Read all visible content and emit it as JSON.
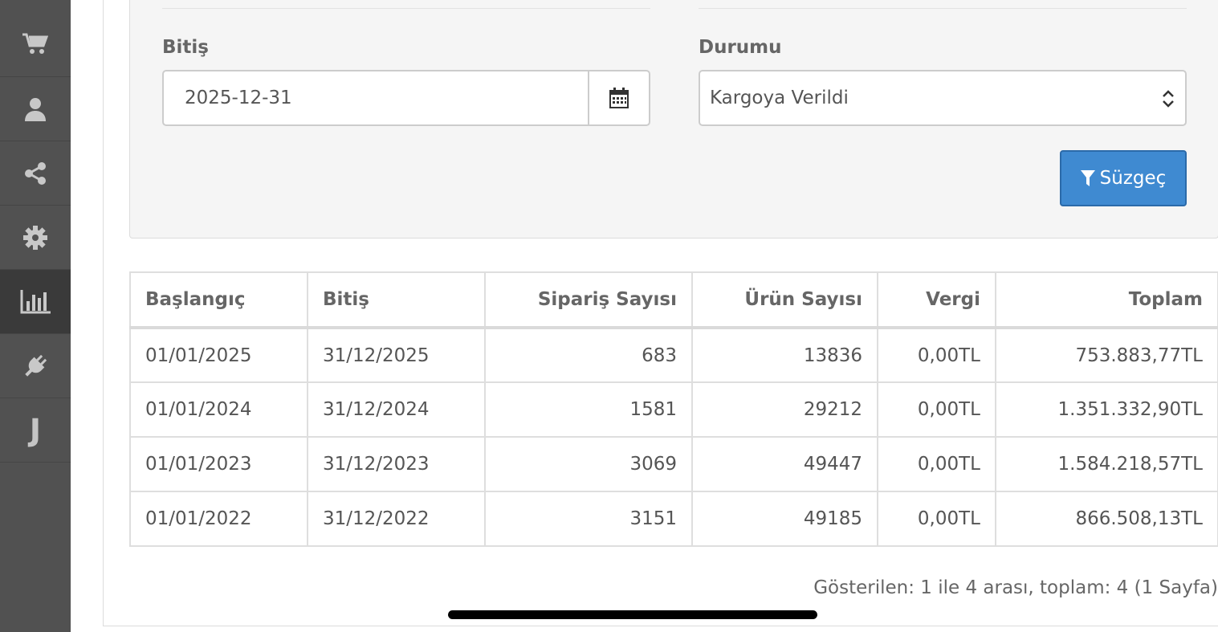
{
  "sidebar": {
    "items": [
      {
        "icon": "cart-icon"
      },
      {
        "icon": "user-icon"
      },
      {
        "icon": "share-icon"
      },
      {
        "icon": "gear-icon"
      },
      {
        "icon": "bar-chart-icon",
        "active": true
      },
      {
        "icon": "plug-icon"
      },
      {
        "icon": "j-letter-icon",
        "text": "J"
      }
    ]
  },
  "filter": {
    "end_label": "Bitiş",
    "end_value": "2025-12-31",
    "status_label": "Durumu",
    "status_value": "Kargoya Verildi",
    "filter_button": "Süzgeç"
  },
  "table": {
    "headers": [
      "Başlangıç",
      "Bitiş",
      "Sipariş Sayısı",
      "Ürün Sayısı",
      "Vergi",
      "Toplam"
    ],
    "rows": [
      [
        "01/01/2025",
        "31/12/2025",
        "683",
        "13836",
        "0,00TL",
        "753.883,77TL"
      ],
      [
        "01/01/2024",
        "31/12/2024",
        "1581",
        "29212",
        "0,00TL",
        "1.351.332,90TL"
      ],
      [
        "01/01/2023",
        "31/12/2023",
        "3069",
        "49447",
        "0,00TL",
        "1.584.218,57TL"
      ],
      [
        "01/01/2022",
        "31/12/2022",
        "3151",
        "49185",
        "0,00TL",
        "866.508,13TL"
      ]
    ]
  },
  "pagination": {
    "text": "Gösterilen: 1 ile 4 arası, toplam: 4 (1 Sayfa)"
  },
  "colors": {
    "sidebar_bg": "#515151",
    "sidebar_active": "#3a3a3a",
    "button_blue": "#3f8ad1",
    "panel_bg": "#f5f5f5"
  }
}
